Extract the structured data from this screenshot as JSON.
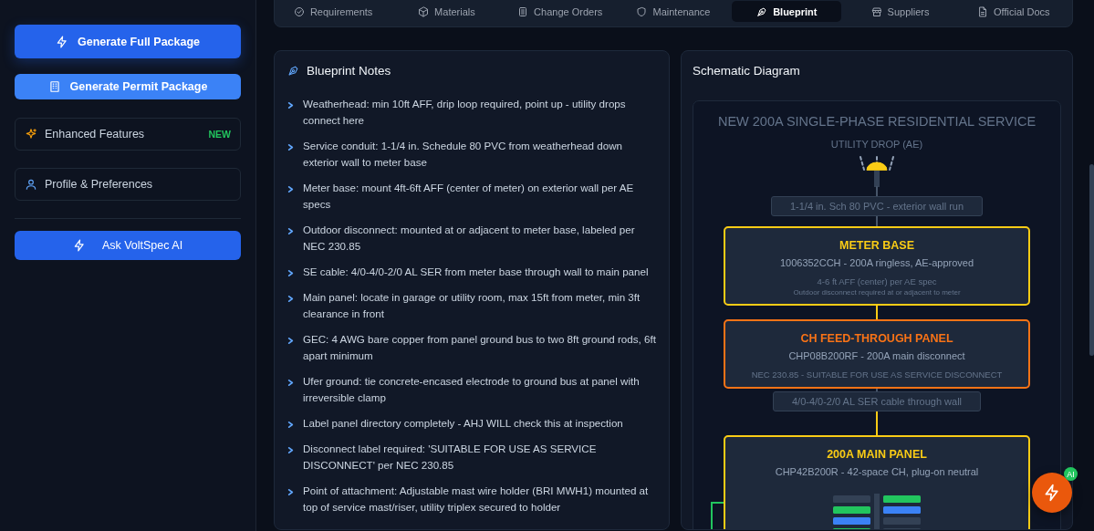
{
  "sidebar": {
    "buttons": [
      {
        "label": "Generate Full Package",
        "kind": "primary"
      },
      {
        "label": "Generate Permit Package",
        "kind": "secondary"
      }
    ],
    "links": [
      {
        "label": "Enhanced Features",
        "kind": "sparkle",
        "badge": "NEW"
      },
      {
        "label": "Profile & Preferences",
        "kind": "user"
      }
    ],
    "assistant_button": {
      "label": "Ask VoltSpec AI"
    }
  },
  "tabs": [
    {
      "label": "Requirements",
      "kind": "check",
      "selected": false
    },
    {
      "label": "Materials",
      "kind": "cube",
      "selected": false
    },
    {
      "label": "Change Orders",
      "kind": "doc",
      "selected": false
    },
    {
      "label": "Maintenance",
      "kind": "shield",
      "selected": false
    },
    {
      "label": "Blueprint",
      "kind": "pen",
      "selected": true
    },
    {
      "label": "Suppliers",
      "kind": "store",
      "selected": false
    },
    {
      "label": "Official Docs",
      "kind": "file",
      "selected": false
    }
  ],
  "notes": {
    "title": "Blueprint Notes",
    "items": [
      "Weatherhead: min 10ft AFF, drip loop required, point up - utility drops connect here",
      "Service conduit: 1-1/4 in. Schedule 80 PVC from weatherhead down exterior wall to meter base",
      "Meter base: mount 4ft-6ft AFF (center of meter) on exterior wall per AE specs",
      "Outdoor disconnect: mounted at or adjacent to meter base, labeled per NEC 230.85",
      "SE cable: 4/0-4/0-2/0 AL SER from meter base through wall to main panel",
      "Main panel: locate in garage or utility room, max 15ft from meter, min 3ft clearance in front",
      "GEC: 4 AWG bare copper from panel ground bus to two 8ft ground rods, 6ft apart minimum",
      "Ufer ground: tie concrete-encased electrode to ground bus at panel with irreversible clamp",
      "Label panel directory completely - AHJ WILL check this at inspection",
      "Disconnect label required: 'SUITABLE FOR USE AS SERVICE DISCONNECT' per NEC 230.85",
      "Point of attachment: Adjustable mast wire holder (BRI MWH1) mounted at top of service mast/riser, utility triplex secured to holder"
    ]
  },
  "schematic": {
    "title": "Schematic Diagram",
    "heading": "NEW 200A SINGLE-PHASE RESIDENTIAL SERVICE",
    "source_label": "UTILITY DROP (AE)",
    "nodes": [
      {
        "kind": "run",
        "text": "1-1/4 in. Sch 80 PVC - exterior wall run"
      },
      {
        "kind": "box",
        "color": "#facc15",
        "title": "METER BASE",
        "subtitle": "1006352CCH - 200A ringless, AE-approved",
        "notes": [
          "4-6 ft AFF (center) per AE spec",
          "Outdoor disconnect required at or adjacent to meter"
        ]
      },
      {
        "kind": "box",
        "color": "#f97316",
        "title": "CH FEED-THROUGH PANEL",
        "subtitle": "CHP08B200RF - 200A main disconnect",
        "notes": [
          "NEC 230.85 - SUITABLE FOR USE AS SERVICE DISCONNECT"
        ]
      },
      {
        "kind": "run",
        "text": "4/0-4/0-2/0 AL SER cable through wall"
      },
      {
        "kind": "panel",
        "color": "#facc15",
        "title": "200A MAIN PANEL",
        "subtitle": "CHP42B200R - 42-space CH, plug-on neutral"
      }
    ]
  },
  "fab": {
    "badge": "AI"
  }
}
